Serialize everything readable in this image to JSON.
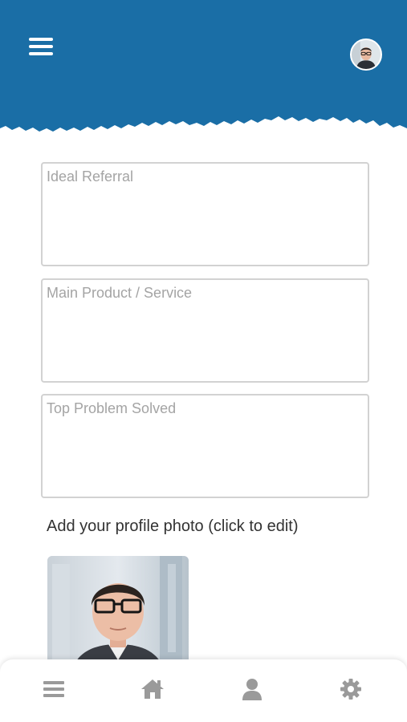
{
  "colors": {
    "header_blue": "#1a6ea6",
    "nav_icon": "#9a9a9a",
    "field_border": "#d2d2d2",
    "placeholder": "#a4a4a4",
    "label_text": "#333333"
  },
  "header": {
    "menu_icon": "hamburger-menu-icon",
    "avatar_icon": "user-avatar"
  },
  "form": {
    "ideal_referral": {
      "value": "",
      "placeholder": "Ideal Referral"
    },
    "main_product": {
      "value": "",
      "placeholder": "Main Product / Service"
    },
    "top_problem": {
      "value": "",
      "placeholder": "Top Problem Solved"
    }
  },
  "photo": {
    "label": "Add your profile photo (click to edit)"
  },
  "bottom_nav": {
    "items": [
      {
        "icon": "menu-icon"
      },
      {
        "icon": "home-icon"
      },
      {
        "icon": "user-icon"
      },
      {
        "icon": "gear-icon"
      }
    ]
  }
}
